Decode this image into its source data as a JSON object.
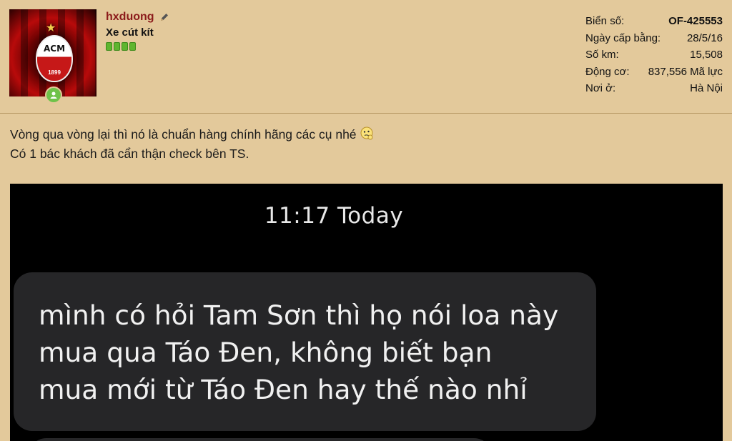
{
  "user": {
    "username": "hxduong",
    "title": "Xe cút kít",
    "avatar_crest_text": "ACM",
    "avatar_crest_year": "1899",
    "rank_bars": 4
  },
  "stats": [
    {
      "label": "Biển số:",
      "value": "OF-425553",
      "bold": true
    },
    {
      "label": "Ngày cấp bằng:",
      "value": "28/5/16"
    },
    {
      "label": "Số km:",
      "value": "15,508"
    },
    {
      "label": "Động cơ:",
      "value": "837,556 Mã lực"
    },
    {
      "label": "Nơi ở:",
      "value": "Hà Nội"
    }
  ],
  "post": {
    "line1": "Vòng qua vòng lại thì nó là chuẩn hàng chính hãng các cụ nhé",
    "line2": "Có 1 bác khách đã cẩn thận check bên TS.",
    "emoji": "thinking-emoji-icon"
  },
  "screenshot": {
    "timestamp": "11:17 Today",
    "message_lines": [
      "mình có hỏi Tam Sơn thì họ nói loa này",
      "mua qua Táo Đen, không biết bạn",
      "mua mới từ Táo Đen hay thế nào nhỉ"
    ]
  },
  "colors": {
    "background": "#e3c99b",
    "username": "#8b1a1a",
    "online": "#6fc24a",
    "bubble": "#262628"
  }
}
